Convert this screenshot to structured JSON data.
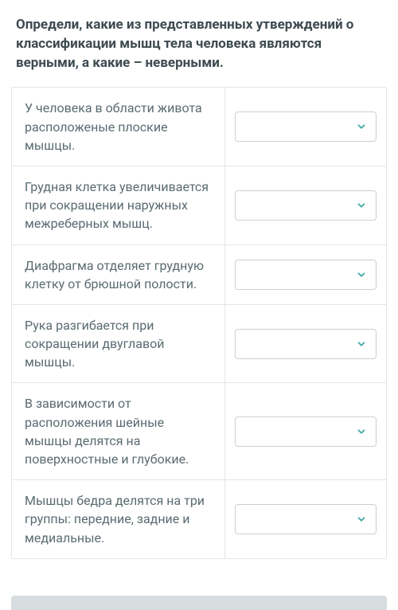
{
  "question": {
    "title": "Определи, какие из представленных утверждений о классификации мышц тела человека являются верными, а какие – неверными."
  },
  "rows": [
    {
      "text": "У человека в области живота расположеные плоские мышцы."
    },
    {
      "text": "Грудная клетка увеличивается при сокращении наружных межреберных мышц."
    },
    {
      "text": "Диафрагма отделяет грудную клетку от брюшной полости."
    },
    {
      "text": "Рука разгибается при сокращении двуглавой мышцы."
    },
    {
      "text": "В зависимости от расположения шейные мышцы делятся на поверхностные и глубокие."
    },
    {
      "text": "Мышцы бедра делятся на три группы: передние, задние и медиальные."
    }
  ],
  "colors": {
    "chevron": "#3aa7a0"
  }
}
